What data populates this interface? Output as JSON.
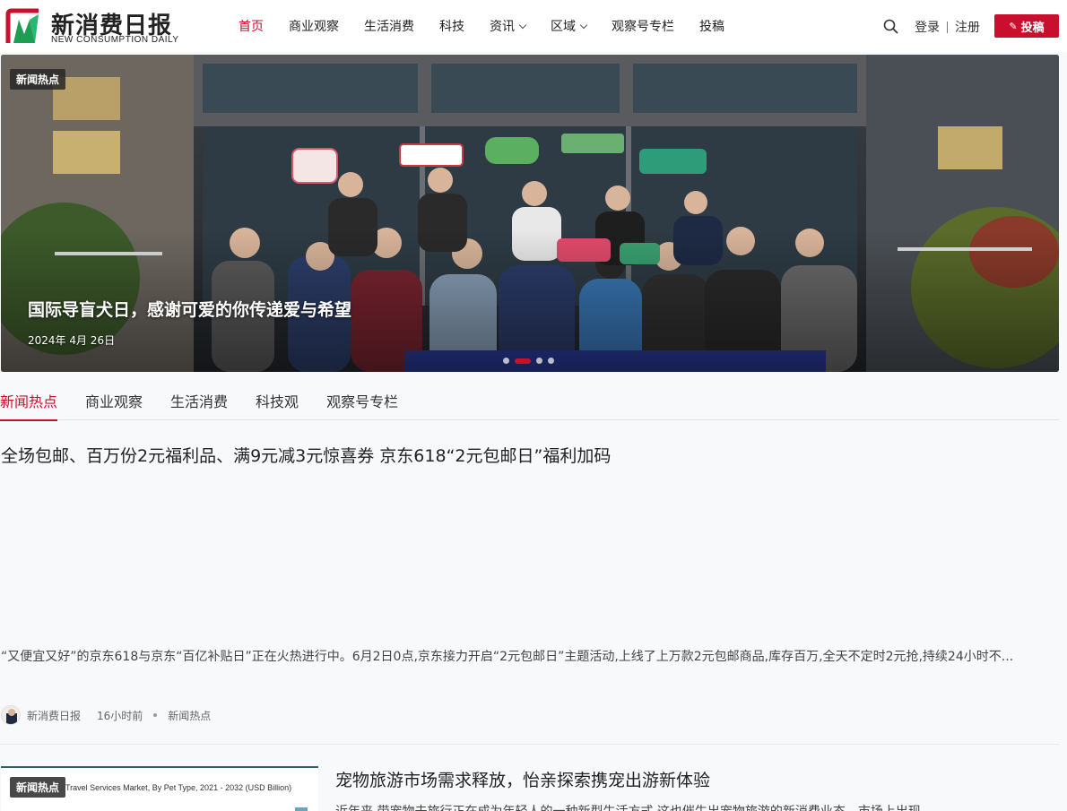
{
  "header": {
    "logo_cn": "新消费日报",
    "logo_en": "NEW CONSUMPTION DAILY",
    "nav": [
      {
        "label": "首页",
        "active": true,
        "dropdown": false
      },
      {
        "label": "商业观察",
        "active": false,
        "dropdown": false
      },
      {
        "label": "生活消费",
        "active": false,
        "dropdown": false
      },
      {
        "label": "科技",
        "active": false,
        "dropdown": false
      },
      {
        "label": "资讯",
        "active": false,
        "dropdown": true
      },
      {
        "label": "区域",
        "active": false,
        "dropdown": true
      },
      {
        "label": "观察号专栏",
        "active": false,
        "dropdown": false
      },
      {
        "label": "投稿",
        "active": false,
        "dropdown": false
      }
    ],
    "login_label": "登录",
    "register_label": "注册",
    "submit_label": "投稿",
    "accent_color": "#c8102e"
  },
  "hero": {
    "tag": "新闻热点",
    "title": "国际导盲犬日，感谢可爱的你传递爱与希望",
    "date": "2024年 4月 26日",
    "slide_count": 4,
    "active_slide": 2
  },
  "tabs": [
    {
      "label": "新闻热点",
      "active": true
    },
    {
      "label": "商业观察",
      "active": false
    },
    {
      "label": "生活消费",
      "active": false
    },
    {
      "label": "科技观",
      "active": false
    },
    {
      "label": "观察号专栏",
      "active": false
    }
  ],
  "articles": [
    {
      "title": "全场包邮、百万份2元福利品、满9元减3元惊喜券 京东618“2元包邮日”福利加码",
      "excerpt": "“又便宜又好”的京东618与京东“百亿补贴日”正在火热进行中。6月2日0点,京东接力开启“2元包邮日”主题活动,上线了上万款2元包邮商品,库存百万,全天不定时2元抢,持续24小时不...",
      "author": "新消费日报",
      "time": "16小时前",
      "category": "新闻热点"
    },
    {
      "tag": "新闻热点",
      "thumb_text": "Travel Services Market, By Pet Type, 2021 - 2032 (USD Billion)",
      "title": "宠物旅游市场需求释放，怡亲探索携宠出游新体验",
      "excerpt": "近年来,带宠物去旅行正在成为年轻人的一种新型生活方式,这也催生出宠物旅游的新消费业态。市场上出现"
    }
  ]
}
